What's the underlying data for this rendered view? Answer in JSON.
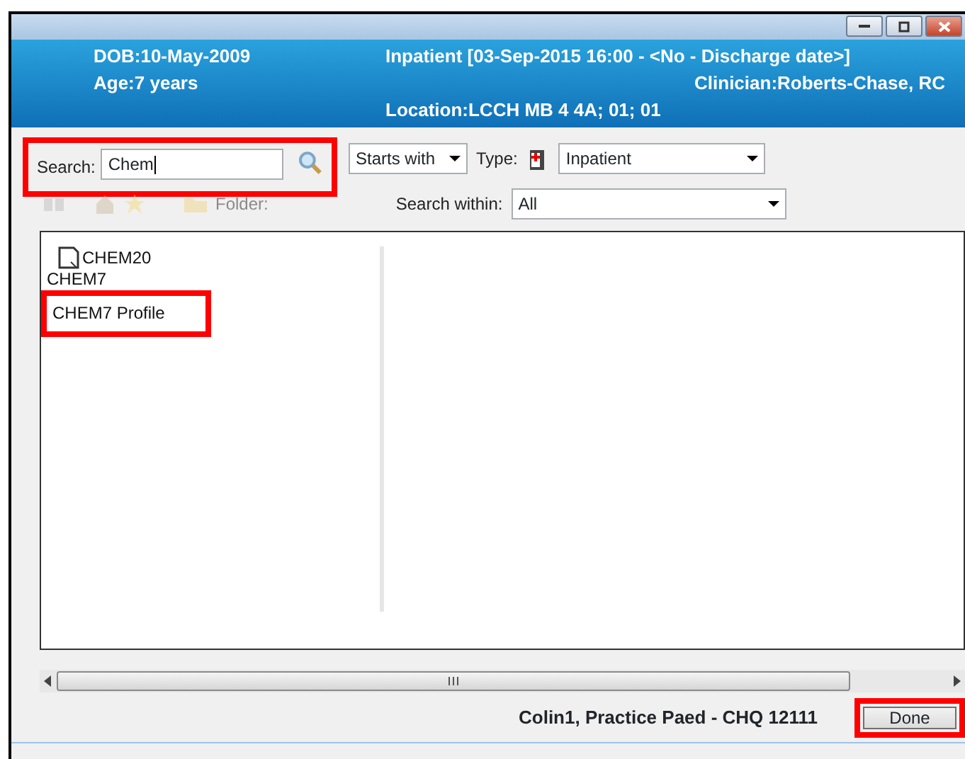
{
  "header": {
    "dob": "DOB:10-May-2009",
    "age": "Age:7 years",
    "encounter": "Inpatient [03-Sep-2015 16:00 - <No - Discharge date>]",
    "clinician": "Clinician:Roberts-Chase, RC",
    "location": "Location:LCCH MB 4 4A; 01; 01"
  },
  "search": {
    "label": "Search:",
    "value": "Chem",
    "highlighted": true
  },
  "match_mode": {
    "value": "Starts with"
  },
  "type": {
    "label": "Type:",
    "value": "Inpatient"
  },
  "toolbar": {
    "folder_label": "Folder:",
    "disabled": true
  },
  "search_within": {
    "label": "Search within:",
    "value": "All"
  },
  "results": [
    {
      "text": "CHEM20",
      "kind": "document",
      "highlighted": false
    },
    {
      "text": "CHEM7",
      "kind": "plain",
      "highlighted": false
    },
    {
      "text": "CHEM7 Profile",
      "kind": "plain",
      "highlighted": true
    }
  ],
  "footer": {
    "patient": "Colin1, Practice Paed - CHQ 12111",
    "done": {
      "label": "Done",
      "highlighted": true
    }
  }
}
